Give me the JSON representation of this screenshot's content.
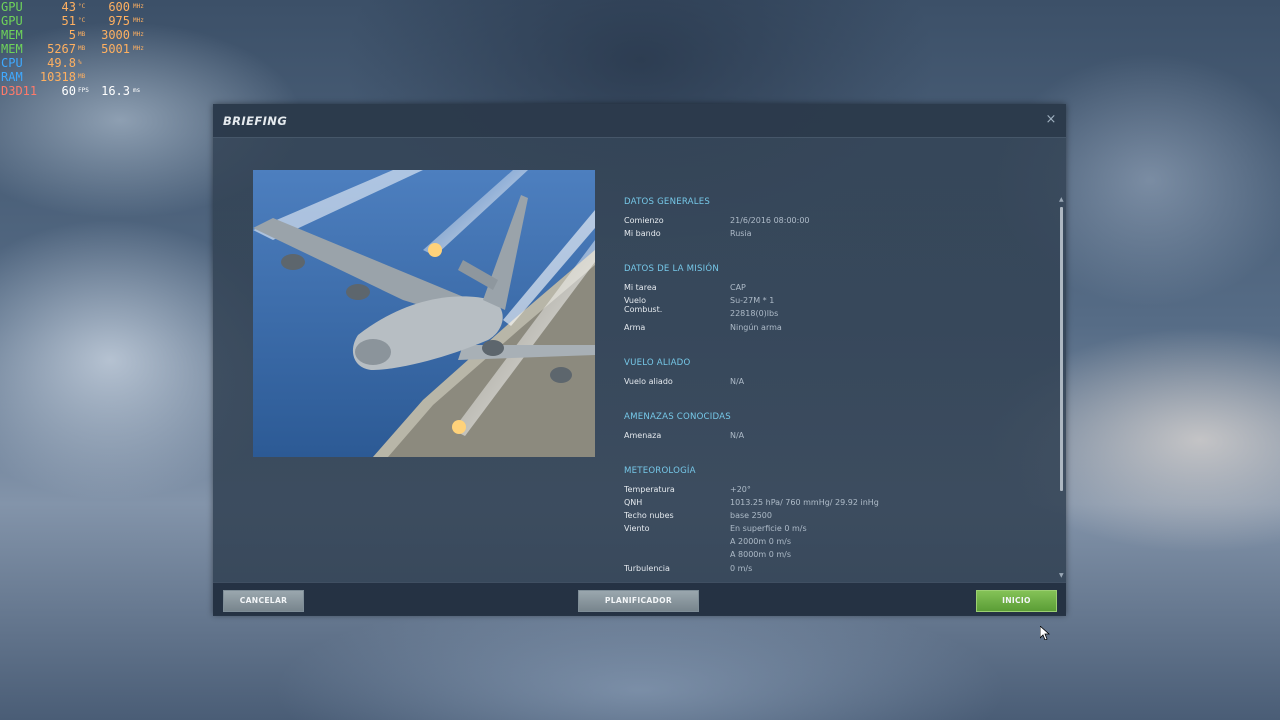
{
  "hud": [
    {
      "name": "GPU",
      "name_color": "#6fd45a",
      "v1": "43",
      "u1": "°C",
      "v2": "600",
      "u2": "MHz"
    },
    {
      "name": "GPU",
      "name_color": "#6fd45a",
      "v1": "51",
      "u1": "°C",
      "v2": "975",
      "u2": "MHz"
    },
    {
      "name": "MEM",
      "name_color": "#6fd45a",
      "v1": "5",
      "u1": "MB",
      "v2": "3000",
      "u2": "MHz"
    },
    {
      "name": "MEM",
      "name_color": "#6fd45a",
      "v1": "5267",
      "u1": "MB",
      "v2": "5001",
      "u2": "MHz"
    },
    {
      "name": "CPU",
      "name_color": "#3fa9ff",
      "v1": "49.8",
      "u1": "%",
      "v2": "",
      "u2": ""
    },
    {
      "name": "RAM",
      "name_color": "#3fa9ff",
      "v1": "10318",
      "u1": "MB",
      "v2": "",
      "u2": ""
    },
    {
      "name": "D3D11",
      "name_color": "#ff7a6a",
      "v1": "60",
      "u1": "FPS",
      "v2": "16.3",
      "u2": "ms",
      "v1_color": "#ffffff",
      "v2_color": "#ffffff",
      "u_color": "#ffffff"
    }
  ],
  "dialog": {
    "title": "BRIEFING",
    "close_glyph": "×"
  },
  "sections": {
    "general": {
      "title": "DATOS GENERALES",
      "start_label": "Comienzo",
      "start_value": "21/6/2016  08:00:00",
      "side_label": "Mi bando",
      "side_value": "Rusia"
    },
    "mission": {
      "title": "DATOS DE LA MISIÓN",
      "task_label": "Mi tarea",
      "task_value": "CAP",
      "flight_label": "Vuelo",
      "flight_value": "Su-27M * 1",
      "fuel_label": "Combust.",
      "fuel_value": "22818(0)lbs",
      "weapon_label": "Arma",
      "weapon_value": "Ningún arma"
    },
    "allied": {
      "title": "VUELO ALIADO",
      "label": "Vuelo aliado",
      "value": "N/A"
    },
    "threats": {
      "title": "AMENAZAS CONOCIDAS",
      "label": "Amenaza",
      "value": "N/A"
    },
    "weather": {
      "title": "METEOROLOGÍA",
      "temp_label": "Temperatura",
      "temp_value": "+20°",
      "qnh_label": "QNH",
      "qnh_value": "1013.25 hPa/ 760 mmHg/ 29.92 inHg",
      "cloud_label": "Techo nubes",
      "cloud_value": "base 2500",
      "wind_label": "Viento",
      "wind_values": [
        "En superficie 0 m/s",
        "A 2000m 0 m/s",
        "A 8000m 0 m/s"
      ],
      "turb_label": "Turbulencia",
      "turb_value": "0 m/s"
    }
  },
  "footer": {
    "cancel_label": "CANCELAR",
    "planner_label": "PLANIFICADOR",
    "start_label": "INICIO"
  }
}
